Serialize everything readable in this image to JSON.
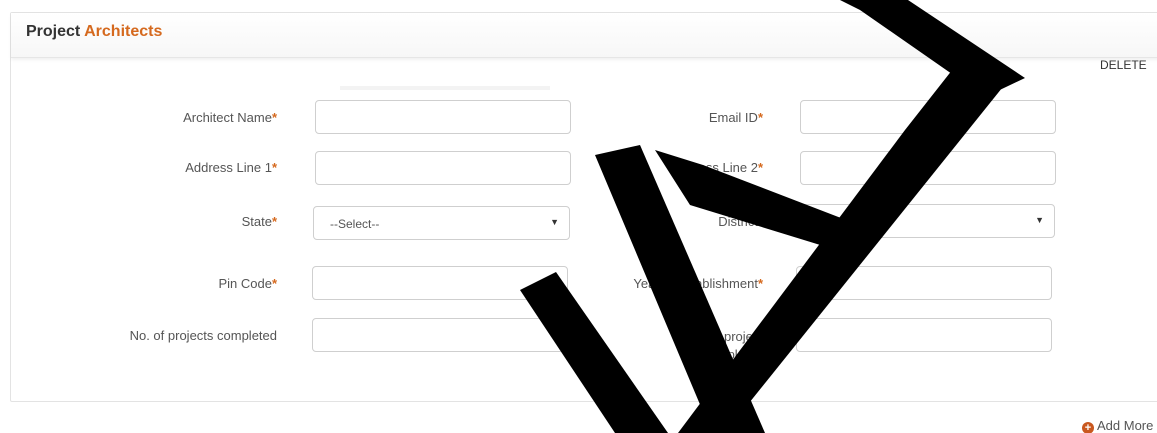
{
  "section": {
    "title_prefix": "Project",
    "title_accent": "Architects",
    "delete_label": "DELETE"
  },
  "fields": {
    "architect_name": {
      "label": "Architect Name",
      "required": "*",
      "value": ""
    },
    "email_id": {
      "label": "Email ID",
      "required": "*",
      "value": ""
    },
    "address_line_1": {
      "label": "Address Line 1",
      "required": "*",
      "value": ""
    },
    "address_line_2": {
      "label": "Address Line 2",
      "required": "*",
      "value": ""
    },
    "state": {
      "label": "State",
      "required": "*",
      "selected": "--Select--"
    },
    "district": {
      "label": "District",
      "required": "*",
      "selected": "--Select--"
    },
    "pin_code": {
      "label": "Pin Code",
      "required": "*",
      "value": ""
    },
    "year_of_establishment": {
      "label": "Year of establishment",
      "required": "*",
      "value": ""
    },
    "projects_completed": {
      "label": "No. of projects completed",
      "value": ""
    },
    "value_of_project_completed": {
      "label": "Value of project Completed",
      "value": ""
    }
  },
  "add_more_label": "Add More",
  "colors": {
    "accent": "#d5691e",
    "border": "#cfcfcf",
    "watermark": "#000000"
  },
  "icons": {
    "add_more": "plus-circle-icon",
    "select_caret": "caret-down-icon"
  }
}
